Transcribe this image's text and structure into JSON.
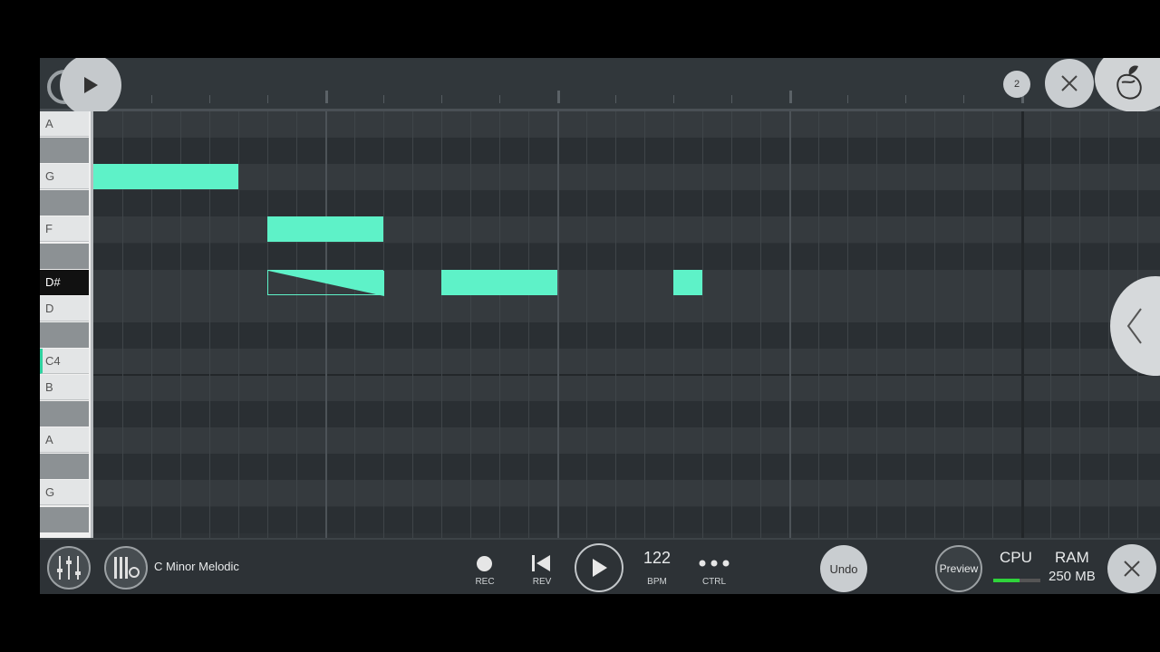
{
  "ruler": {
    "pattern_number": "2"
  },
  "keyboard": {
    "keys": [
      {
        "label": "A",
        "type": "white"
      },
      {
        "label": "",
        "type": "black"
      },
      {
        "label": "G",
        "type": "white"
      },
      {
        "label": "",
        "type": "black"
      },
      {
        "label": "F",
        "type": "white"
      },
      {
        "label": "",
        "type": "black"
      },
      {
        "label": "D#",
        "type": "active"
      },
      {
        "label": "D",
        "type": "white"
      },
      {
        "label": "",
        "type": "black"
      },
      {
        "label": "C4",
        "type": "white"
      },
      {
        "label": "B",
        "type": "white"
      },
      {
        "label": "",
        "type": "black"
      },
      {
        "label": "A",
        "type": "white"
      },
      {
        "label": "",
        "type": "black"
      },
      {
        "label": "G",
        "type": "white"
      },
      {
        "label": "",
        "type": "black"
      }
    ]
  },
  "notes": [
    {
      "pitch": "G",
      "start_step": 0,
      "length_steps": 5
    },
    {
      "pitch": "F",
      "start_step": 6,
      "length_steps": 4
    },
    {
      "pitch": "D#",
      "start_step": 6,
      "length_steps": 4,
      "style": "slide"
    },
    {
      "pitch": "D#",
      "start_step": 12,
      "length_steps": 4
    },
    {
      "pitch": "D#",
      "start_step": 20,
      "length_steps": 1
    }
  ],
  "toolbar": {
    "scale_label": "C Minor Melodic",
    "rec_label": "REC",
    "rev_label": "REV",
    "tempo_value": "122",
    "bpm_label": "BPM",
    "ctrl_label": "CTRL",
    "undo_label": "Undo",
    "preview_label": "Preview",
    "cpu_label": "CPU",
    "ram_label": "RAM",
    "ram_value": "250 MB",
    "cpu_level": 0.55
  },
  "colors": {
    "note": "#5ef2c8",
    "background": "#2e3337",
    "cpu_meter": "#2fd33b"
  }
}
